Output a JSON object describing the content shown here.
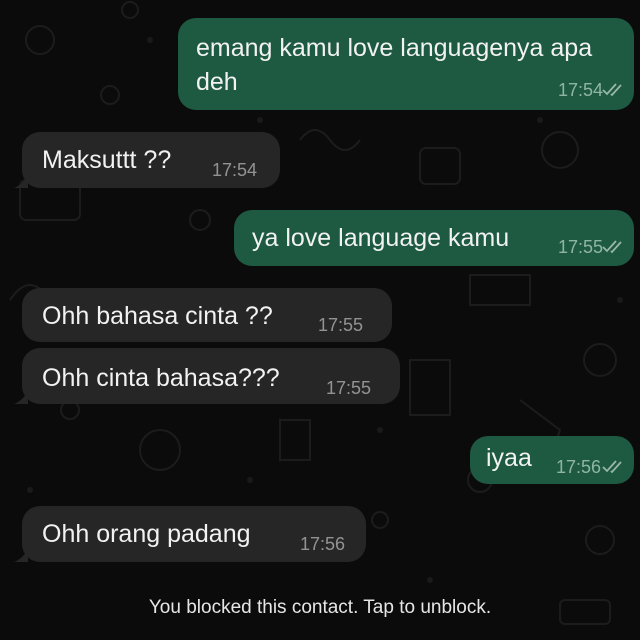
{
  "messages": [
    {
      "direction": "outgoing",
      "text_line1": "emang kamu love languagenya apa",
      "text_line2": "deh",
      "time": "17:54",
      "status": "read"
    },
    {
      "direction": "incoming",
      "text": "Maksuttt ??",
      "time": "17:54"
    },
    {
      "direction": "outgoing",
      "text": "ya love language kamu",
      "time": "17:55",
      "status": "read"
    },
    {
      "direction": "incoming",
      "text": "Ohh bahasa cinta ??",
      "time": "17:55"
    },
    {
      "direction": "incoming",
      "text": "Ohh cinta bahasa???",
      "time": "17:55"
    },
    {
      "direction": "outgoing",
      "text": "iyaa",
      "time": "17:56",
      "status": "read"
    },
    {
      "direction": "incoming",
      "text": "Ohh orang padang",
      "time": "17:56"
    }
  ],
  "footer": {
    "blocked_notice": "You blocked this contact. Tap to unblock."
  },
  "colors": {
    "background": "#0b0b0b",
    "incoming_bubble": "#262626",
    "outgoing_bubble": "#1d5a41",
    "text": "#f2f2f2",
    "wallpaper_doodles": "#1c1c1c"
  },
  "icons": {
    "read_receipt": "double-check-icon"
  }
}
